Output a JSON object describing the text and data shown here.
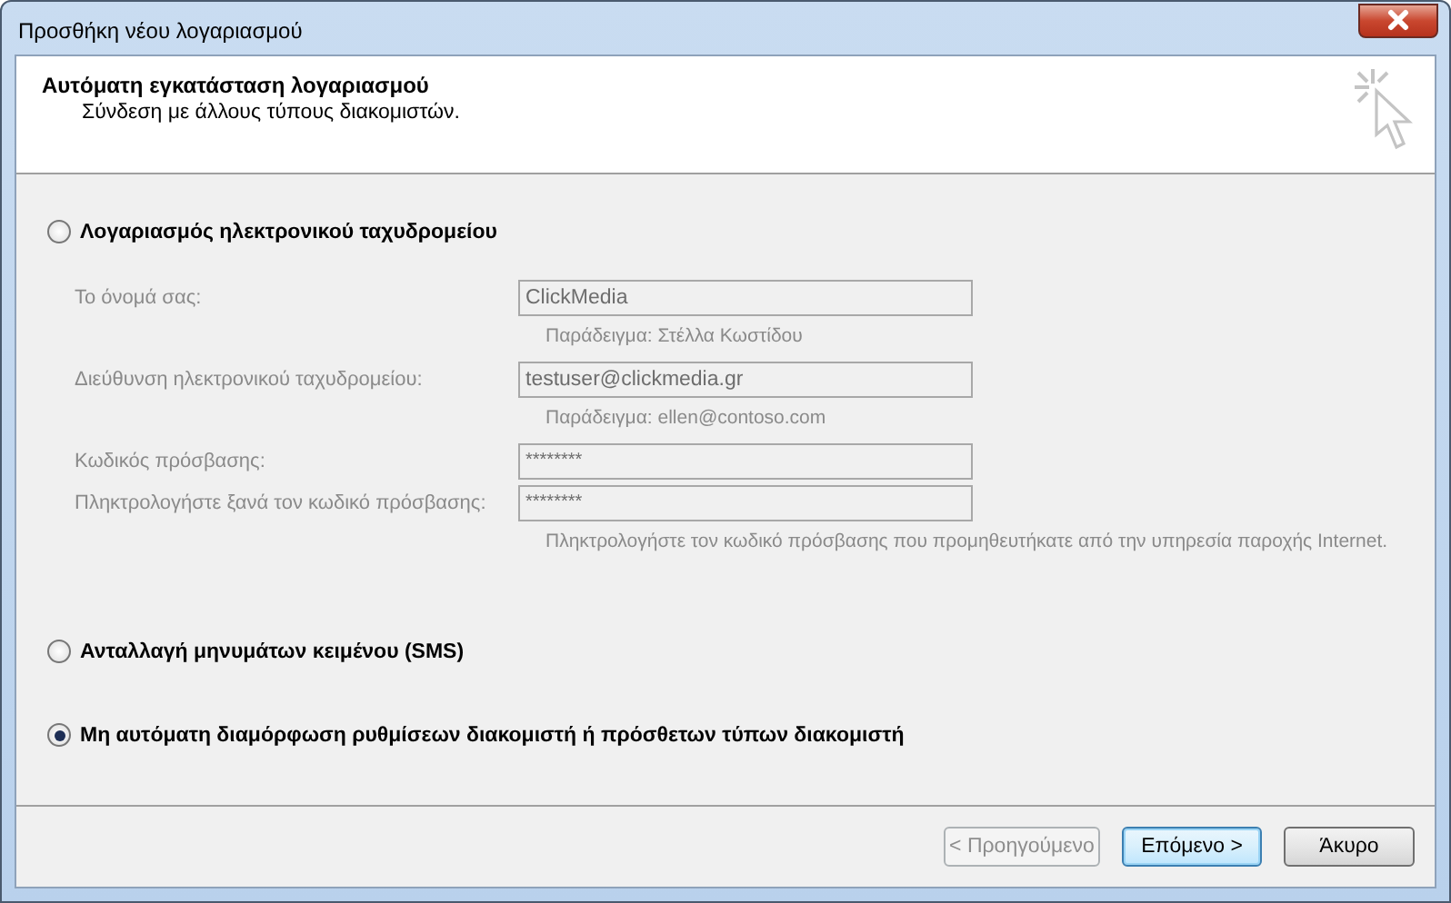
{
  "window": {
    "title": "Προσθήκη νέου λογαριασμού"
  },
  "header": {
    "title": "Αυτόματη εγκατάσταση λογαριασμού",
    "subtitle": "Σύνδεση με άλλους τύπους διακομιστών."
  },
  "options": [
    {
      "label": "Λογαριασμός ηλεκτρονικού ταχυδρομείου",
      "selected": false,
      "fields": [
        {
          "label": "Το όνομά σας:",
          "value": "ClickMedia",
          "hint": "Παράδειγμα: Στέλλα Κωστίδου",
          "disabled": true
        },
        {
          "label": "Διεύθυνση ηλεκτρονικού ταχυδρομείου:",
          "value": "testuser@clickmedia.gr",
          "hint": "Παράδειγμα: ellen@contoso.com",
          "disabled": true
        },
        {
          "label": "Κωδικός πρόσβασης:",
          "value": "********",
          "disabled": true
        },
        {
          "label": "Πληκτρολογήστε ξανά τον κωδικό πρόσβασης:",
          "value": "********",
          "hint": "Πληκτρολογήστε τον κωδικό πρόσβασης που προμηθευτήκατε από την υπηρεσία παροχής Internet.",
          "disabled": true
        }
      ]
    },
    {
      "label": "Ανταλλαγή μηνυμάτων κειμένου (SMS)",
      "selected": false
    },
    {
      "label": "Μη αυτόματη διαμόρφωση ρυθμίσεων διακομιστή ή πρόσθετων τύπων διακομιστή",
      "selected": true
    }
  ],
  "buttons": [
    {
      "label": "< Προηγούμενο",
      "disabled": true,
      "default": false
    },
    {
      "label": "Επόμενο >",
      "disabled": false,
      "default": true
    },
    {
      "label": "Άκυρο",
      "disabled": false,
      "default": false
    }
  ]
}
